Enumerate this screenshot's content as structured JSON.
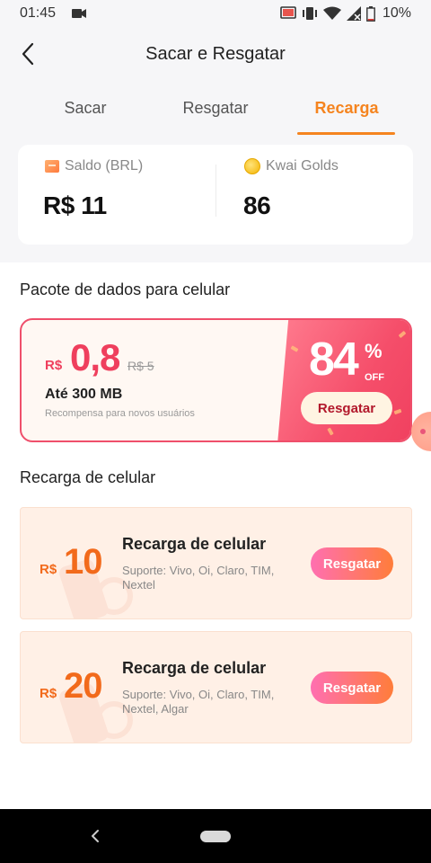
{
  "status_bar": {
    "time": "01:45",
    "battery": "10%"
  },
  "header": {
    "title": "Sacar e Resgatar"
  },
  "tabs": [
    {
      "label": "Sacar"
    },
    {
      "label": "Resgatar"
    },
    {
      "label": "Recarga",
      "active": true
    }
  ],
  "balance": {
    "brl_label": "Saldo (BRL)",
    "brl_value": "R$ 11",
    "gold_label": "Kwai Golds",
    "gold_value": "86"
  },
  "data_package": {
    "section_title": "Pacote de dados para celular",
    "currency": "R$",
    "price": "0,8",
    "old_price": "R$ 5",
    "size": "Até 300 MB",
    "note": "Recompensa para novos usuários",
    "discount": "84",
    "discount_pct": "%",
    "discount_off": "OFF",
    "button": "Resgatar",
    "colors": {
      "accent": "#ef3f5d"
    }
  },
  "recharge": {
    "section_title": "Recarga de celular",
    "items": [
      {
        "currency": "R$",
        "amount": "10",
        "title": "Recarga de celular",
        "support": "Suporte: Vivo, Oi, Claro, TIM, Nextel",
        "button": "Resgatar"
      },
      {
        "currency": "R$",
        "amount": "20",
        "title": "Recarga de celular",
        "support": "Suporte: Vivo, Oi, Claro, TIM, Nextel, Algar",
        "button": "Resgatar"
      }
    ]
  },
  "theme": {
    "primary": "#f5841f",
    "recharge_accent": "#f26a1b"
  },
  "icons": [
    "video-icon",
    "cast-icon",
    "vibrate-icon",
    "wifi-icon",
    "signal-icon",
    "battery-icon",
    "back-arrow-icon",
    "wallet-icon",
    "coin-icon",
    "nav-back-icon",
    "nav-home-icon"
  ]
}
